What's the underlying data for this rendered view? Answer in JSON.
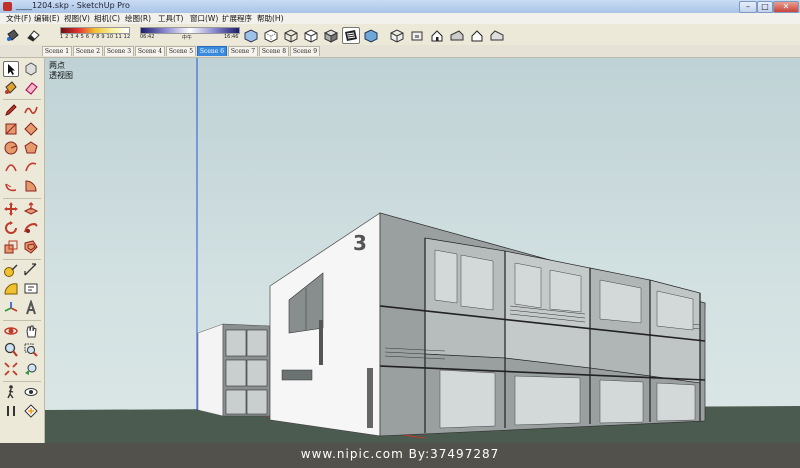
{
  "window": {
    "title": "____1204.skp - SketchUp Pro",
    "controls": {
      "minimize": "–",
      "maximize": "□",
      "close": "✕"
    }
  },
  "menu": [
    {
      "label": "文件(F)"
    },
    {
      "label": "编辑(E)"
    },
    {
      "label": "视图(V)"
    },
    {
      "label": "相机(C)"
    },
    {
      "label": "绘图(R)"
    },
    {
      "label": "工具(T)"
    },
    {
      "label": "窗口(W)"
    },
    {
      "label": "扩展程序"
    },
    {
      "label": "帮助(H)"
    }
  ],
  "shadow_settings": {
    "month_scale": "1 2 3 4 5 6 7 8 9 10 11 12",
    "time_start": "06:42",
    "time_mid": "中午",
    "time_end": "16:46",
    "month_gradient_colors": [
      "#6a1010",
      "#e03030",
      "#f2c030",
      "#f8f0a0",
      "#ffffff"
    ],
    "time_gradient_colors": [
      "#1c1c6a",
      "#8a8ad0",
      "#ffffff"
    ]
  },
  "toolbar_icons": [
    "paint-bucket-icon",
    "eraser-icon",
    "xray-style-icon",
    "back-edges-style-icon",
    "wireframe-style-icon",
    "hidden-line-style-icon",
    "shaded-style-icon",
    "shaded-textures-style-icon",
    "monochrome-style-icon",
    "iso-view-icon",
    "top-view-icon",
    "front-view-icon",
    "right-view-icon",
    "back-view-icon",
    "left-view-icon"
  ],
  "scenes": {
    "active_index": 5,
    "tabs": [
      {
        "label": "Scene 1"
      },
      {
        "label": "Scene 2"
      },
      {
        "label": "Scene 3"
      },
      {
        "label": "Scene 4"
      },
      {
        "label": "Scene 5"
      },
      {
        "label": "Scene 6"
      },
      {
        "label": "Scene 7"
      },
      {
        "label": "Scene 8"
      },
      {
        "label": "Scene 9"
      }
    ]
  },
  "left_tools": [
    "select-icon",
    "make-component-icon",
    "paint-bucket-icon",
    "eraser-icon",
    "pencil-icon",
    "freehand-icon",
    "rectangle-icon",
    "rotated-rectangle-icon",
    "circle-icon",
    "polygon-icon",
    "arc-icon",
    "two-point-arc-icon",
    "three-point-arc-icon",
    "pie-icon",
    "move-icon",
    "push-pull-icon",
    "rotate-icon",
    "follow-me-icon",
    "scale-icon",
    "offset-icon",
    "tape-measure-icon",
    "dimension-icon",
    "protractor-icon",
    "text-icon",
    "axes-icon",
    "3d-text-icon",
    "orbit-icon",
    "pan-icon",
    "zoom-icon",
    "zoom-window-icon",
    "zoom-extents-icon",
    "previous-view-icon",
    "walk-icon",
    "look-around-icon",
    "position-camera-icon",
    "section-plane-icon"
  ],
  "viewport": {
    "view_label_line1": "两点",
    "view_label_line2": "透视图",
    "building_number": "3",
    "sky_color": "#c4d6d8",
    "ground_color": "#4b5b4f"
  },
  "watermark": {
    "text": "www.nipic.com  By:37497287"
  }
}
